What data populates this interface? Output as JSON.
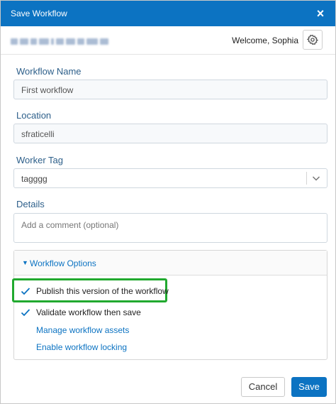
{
  "dialog": {
    "title": "Save Workflow",
    "close_glyph": "×"
  },
  "userbar": {
    "welcome": "Welcome, Sophia"
  },
  "form": {
    "workflow_name_label": "Workflow Name",
    "workflow_name_value": "First workflow",
    "location_label": "Location",
    "location_value": "sfraticelli",
    "worker_tag_label": "Worker Tag",
    "worker_tag_value": "tagggg",
    "details_label": "Details",
    "details_placeholder": "Add a comment (optional)"
  },
  "options": {
    "header": "Workflow Options",
    "publish_label": "Publish this version of the workflow",
    "publish_checked": true,
    "validate_label": "Validate workflow then save",
    "validate_checked": true,
    "manage_assets_link": "Manage workflow assets",
    "locking_link": "Enable workflow locking"
  },
  "buttons": {
    "cancel": "Cancel",
    "save": "Save"
  },
  "colors": {
    "accent": "#0c73c2",
    "highlight": "#21a92f"
  },
  "icons": {
    "close": "close-icon",
    "settings": "gear-icon",
    "dropdown": "chevron-down-icon",
    "check": "check-icon",
    "expand": "triangle-down-icon"
  }
}
